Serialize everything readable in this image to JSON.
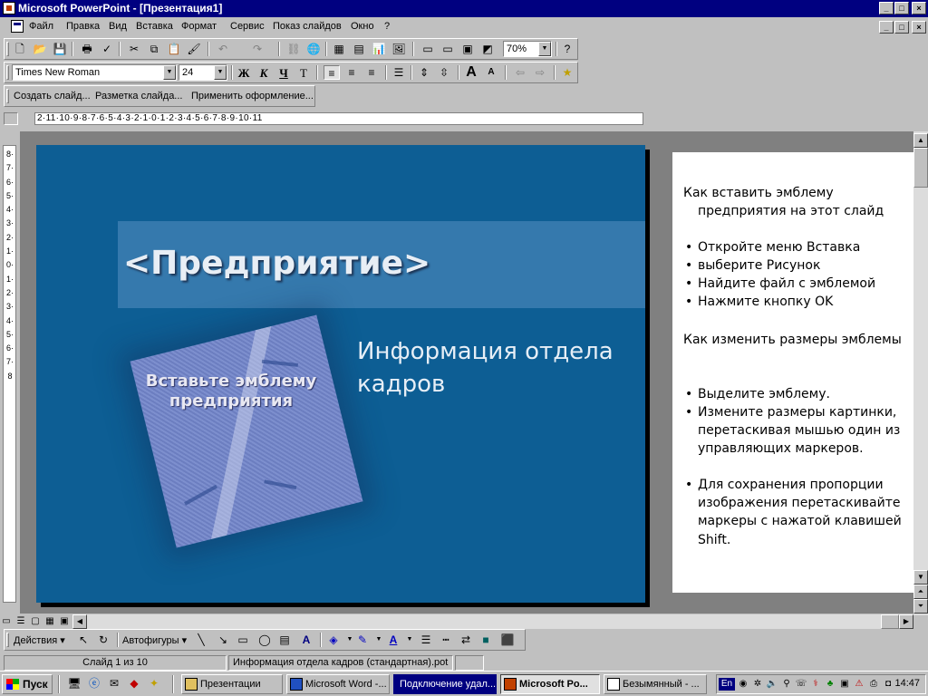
{
  "window": {
    "title": "Microsoft PowerPoint - [Презентация1]",
    "controls": [
      "_",
      "□",
      "×"
    ]
  },
  "menu": {
    "items": [
      "Файл",
      "Правка",
      "Вид",
      "Вставка",
      "Формат",
      "Сервис",
      "Показ слайдов",
      "Окно",
      "?"
    ]
  },
  "standard_toolbar": {
    "zoom": "70%"
  },
  "formatting_toolbar": {
    "font": "Times New Roman",
    "size": "24",
    "bold": "Ж",
    "italic": "К",
    "underline": "Ч",
    "shadow": "Т"
  },
  "common_tasks": {
    "new_slide": "Создать слайд...",
    "layout": "Разметка слайда...",
    "apply_design": "Применить оформление..."
  },
  "slide": {
    "title": "<Предприятие>",
    "logo_placeholder": "Вставьте эмблему предприятия",
    "subtitle": "Информация отдела кадров",
    "background": "#0d5e94"
  },
  "notes": {
    "heading1": "Как вставить эмблему предприятия на этот слайд",
    "bullets1": [
      "Откройте меню Вставка",
      "выберите Рисунок",
      "Найдите файл с эмблемой",
      "Нажмите кнопку OK"
    ],
    "heading2": "Как изменить размеры эмблемы",
    "bullets2": [
      "Выделите эмблему.",
      "Измените размеры картинки, перетаскивая мышью один из управляющих маркеров.",
      "Для сохранения пропорции изображения перетаскивайте маркеры с нажатой клавишей Shift."
    ]
  },
  "hruler": "2·11·10·9·8·7·6·5·4·3·2·1·0·1·2·3·4·5·6·7·8·9·10·11",
  "vruler": "8·7·6·5·4·3·2·1·0·1·2·3·4·5·6·7·8",
  "drawing_toolbar": {
    "actions": "Действия",
    "autoshapes": "Автофигуры"
  },
  "status": {
    "slide": "Слайд 1 из 10",
    "template": "Информация отдела кадров (стандартная).pot"
  },
  "taskbar": {
    "start": "Пуск",
    "tasks": [
      "Презентации",
      "Microsoft Word -...",
      "Подключение удал...",
      "Microsoft Po...",
      "Безымянный - ..."
    ],
    "lang": "En",
    "clock": "14:47"
  },
  "colors": {
    "titlebar": "#000080",
    "slide_bg": "#0d5e94",
    "workspace": "#808080"
  }
}
